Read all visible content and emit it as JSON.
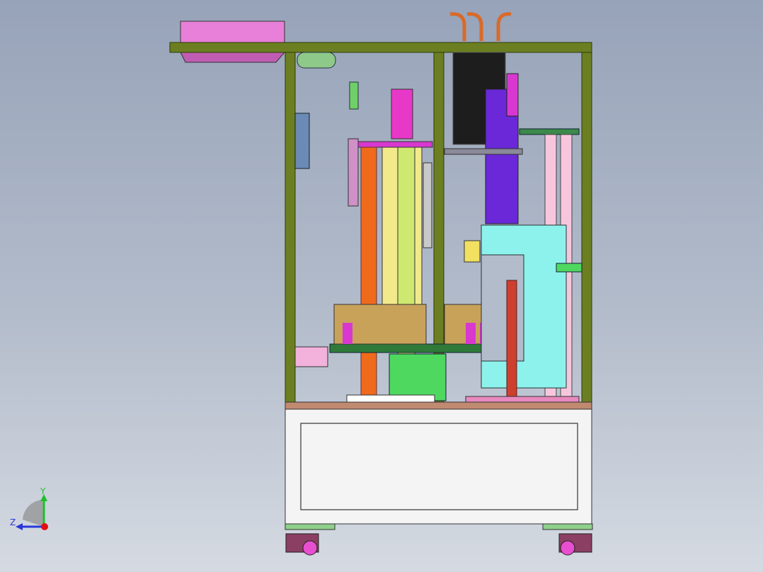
{
  "view": {
    "background_top": "#97a3b9",
    "background_bottom": "#d5dae2"
  },
  "triad": {
    "y_label": "Y",
    "z_label": "Z",
    "y_color": "#1fbf2a",
    "z_color": "#2a38d8",
    "x_color": "#e01010"
  },
  "colors": {
    "frame": "#6b7f22",
    "frame_edge": "#2d3a08",
    "panel_pink": "#e87fd8",
    "base_white": "#f4f4f4",
    "orange_column": "#f06a1c",
    "yellow_plate": "#f2ea8a",
    "purple_cylinder": "#6a28d8",
    "cyan_body": "#8ef2ec",
    "pink_column": "#f7c6dd",
    "green_block": "#4fd860",
    "dark_cylinder": "#1d1d1d",
    "magenta": "#d838d0",
    "copper": "#d86a2a",
    "brown_top": "#9c5a3c"
  }
}
